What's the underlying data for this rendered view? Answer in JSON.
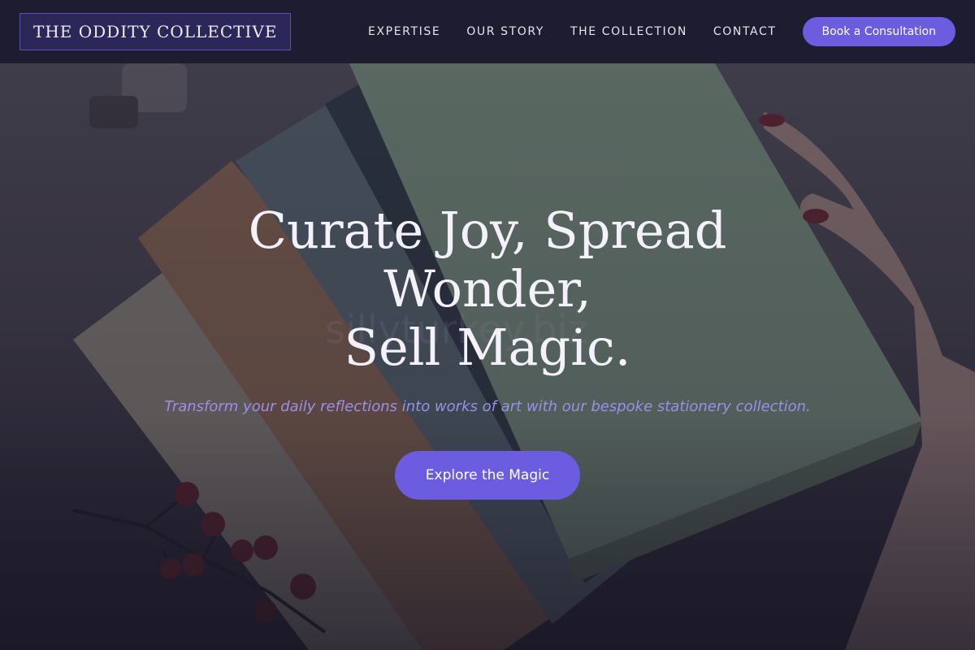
{
  "header": {
    "logo": "THE ODDITY COLLECTIVE",
    "nav": [
      "EXPERTISE",
      "OUR STORY",
      "THE COLLECTION",
      "CONTACT"
    ],
    "cta_label": "Book a Consultation"
  },
  "hero": {
    "title_line1": "Curate Joy, Spread Wonder,",
    "title_line2": "Sell Magic.",
    "subtitle": "Transform your daily reflections into works of art with our bespoke stationery collection.",
    "button_label": "Explore the Magic",
    "watermark": "sillyturkey.biz",
    "background_image": "notebooks-fanned-hand-berries"
  },
  "colors": {
    "accent": "#6b5ce0",
    "header_bg": "#1d1c30",
    "subtitle": "#9b8fe8"
  }
}
